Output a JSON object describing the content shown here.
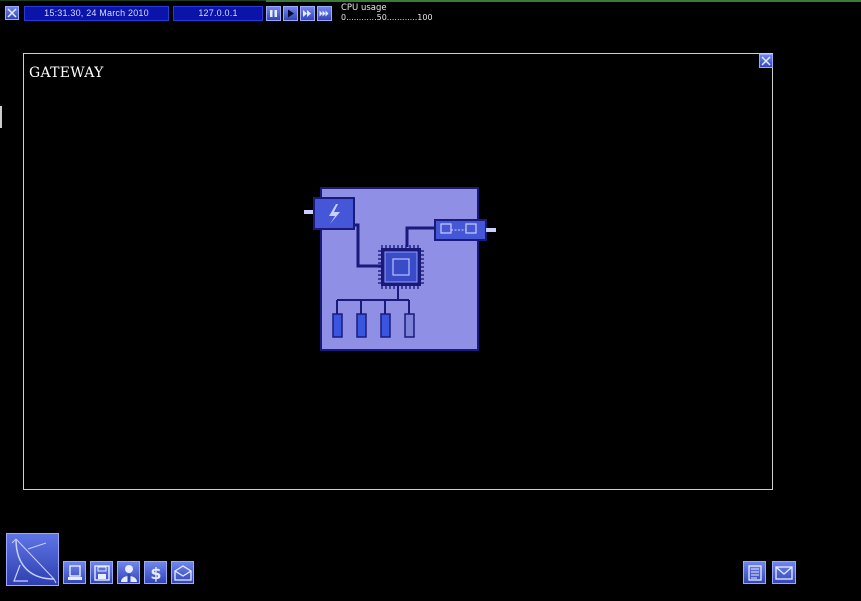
{
  "topbar": {
    "datetime": "15:31.30, 24 March 2010",
    "ip": "127.0.0.1",
    "cpu_label": "CPU usage",
    "cpu_scale": "0............50............100",
    "exit_icon": "close-icon",
    "speed_controls": [
      "pause-icon",
      "play-icon",
      "fast-forward-icon",
      "fastest-forward-icon"
    ]
  },
  "panel": {
    "title": "GATEWAY",
    "close_icon": "close-icon",
    "image": "gateway-hardware-diagram"
  },
  "bottom": {
    "main_menu_icon": "satellite-dish-icon",
    "left_buttons": [
      "computer-icon",
      "floppy-disk-icon",
      "person-icon",
      "dollar-icon",
      "mail-icon"
    ],
    "right_buttons": [
      "notes-icon",
      "email-icon"
    ]
  },
  "colors": {
    "accent": "#3346b8",
    "pill_bg": "#0a14a8",
    "gateway_board": "#8f8fe6"
  }
}
